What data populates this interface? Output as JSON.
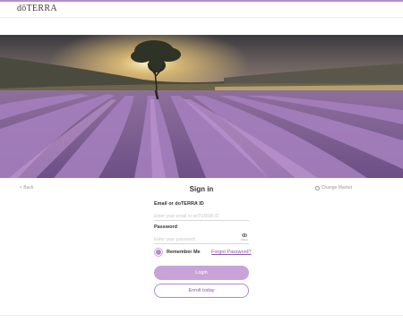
{
  "brand": {
    "logo_text": "dōTERRA",
    "accent_color": "#b88fc9"
  },
  "hero": {
    "image": "lavender-field-sunset"
  },
  "nav": {
    "back_label": "< Back",
    "change_market_label": "Change Market",
    "change_market_icon": "globe-icon"
  },
  "signin": {
    "title": "Sign in",
    "email_label": "Email or doTERRA ID",
    "email_placeholder": "Enter your email or doTERRA ID",
    "password_label": "Password",
    "password_placeholder": "Enter your password",
    "show_password_label": "Show",
    "remember_label": "Remember Me",
    "remember_checked": true,
    "forgot_label": "Forgot Password?",
    "login_label": "Login",
    "enroll_label": "Enroll today"
  }
}
